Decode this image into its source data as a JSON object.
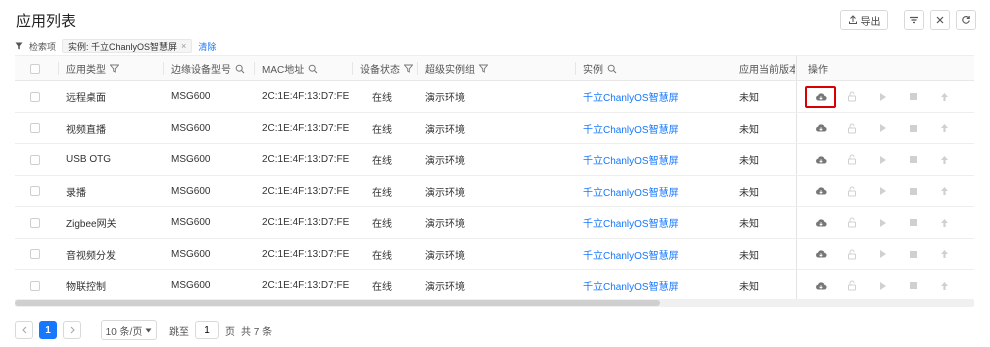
{
  "page": {
    "title": "应用列表"
  },
  "toolbar": {
    "export_label": "导出"
  },
  "filters": {
    "label": "检索项",
    "tag": "实例: 千立ChanlyOS智慧屏",
    "clear_label": "清除"
  },
  "table": {
    "columns": {
      "type": "应用类型",
      "model": "边缘设备型号",
      "mac": "MAC地址",
      "status": "设备状态",
      "group": "超级实例组",
      "instance": "实例",
      "version": "应用当前版本",
      "ops": "操作"
    },
    "rows": [
      {
        "type": "远程桌面",
        "model": "MSG600",
        "mac": "2C:1E:4F:13:D7:FE",
        "status": "在线",
        "group": "演示环境",
        "instance": "千立ChanlyOS智慧屏",
        "version": "未知"
      },
      {
        "type": "视频直播",
        "model": "MSG600",
        "mac": "2C:1E:4F:13:D7:FE",
        "status": "在线",
        "group": "演示环境",
        "instance": "千立ChanlyOS智慧屏",
        "version": "未知"
      },
      {
        "type": "USB OTG",
        "model": "MSG600",
        "mac": "2C:1E:4F:13:D7:FE",
        "status": "在线",
        "group": "演示环境",
        "instance": "千立ChanlyOS智慧屏",
        "version": "未知"
      },
      {
        "type": "录播",
        "model": "MSG600",
        "mac": "2C:1E:4F:13:D7:FE",
        "status": "在线",
        "group": "演示环境",
        "instance": "千立ChanlyOS智慧屏",
        "version": "未知"
      },
      {
        "type": "Zigbee网关",
        "model": "MSG600",
        "mac": "2C:1E:4F:13:D7:FE",
        "status": "在线",
        "group": "演示环境",
        "instance": "千立ChanlyOS智慧屏",
        "version": "未知"
      },
      {
        "type": "音视频分发",
        "model": "MSG600",
        "mac": "2C:1E:4F:13:D7:FE",
        "status": "在线",
        "group": "演示环境",
        "instance": "千立ChanlyOS智慧屏",
        "version": "未知"
      },
      {
        "type": "物联控制",
        "model": "MSG600",
        "mac": "2C:1E:4F:13:D7:FE",
        "status": "在线",
        "group": "演示环境",
        "instance": "千立ChanlyOS智慧屏",
        "version": "未知"
      }
    ]
  },
  "pagination": {
    "current_page": "1",
    "page_size": "10 条/页",
    "goto_label": "跳至",
    "goto_value": "1",
    "page_unit": "页",
    "total": "共 7 条"
  },
  "colors": {
    "accent": "#1677ff",
    "highlight": "#d80000"
  },
  "icons": [
    "upload-icon",
    "filter-icon",
    "close-icon",
    "refresh-icon",
    "search-icon",
    "cloud-download-icon",
    "unlock-icon",
    "play-icon",
    "stop-icon",
    "arrow-up-icon",
    "chevron-left-icon",
    "chevron-right-icon",
    "caret-down-icon"
  ]
}
